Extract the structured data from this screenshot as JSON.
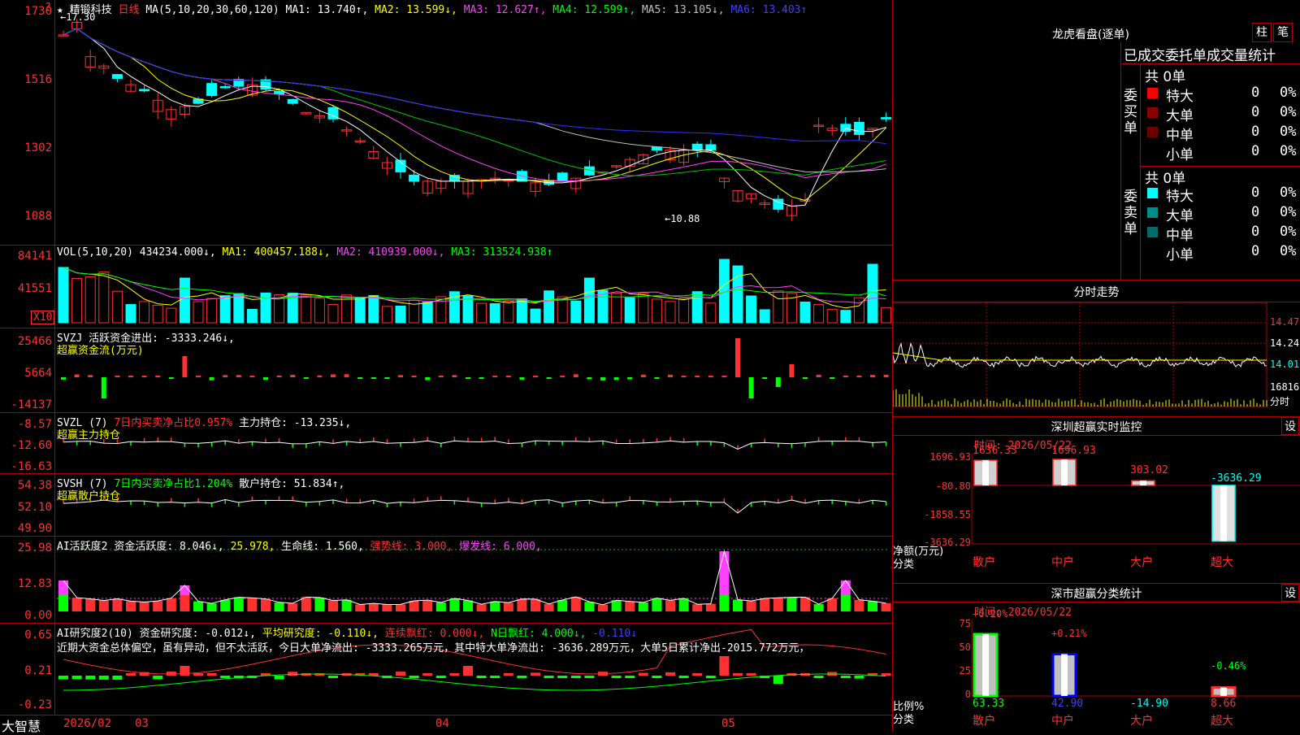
{
  "main": {
    "stock": "精锻科技",
    "period": "日线",
    "ma_label": "MA(5,10,20,30,60,120)",
    "ma1": "MA1: 13.740↑,",
    "ma2": "MA2: 13.599↓,",
    "ma3": "MA3: 12.627↑,",
    "ma4": "MA4: 12.599↑,",
    "ma5": "MA5: 13.105↓,",
    "ma6": "MA6: 13.403↑",
    "high_mark": "←17.30",
    "low_mark": "←10.88",
    "y_labels": [
      "1730",
      "1516",
      "1302",
      "1088"
    ],
    "corner": "?"
  },
  "vol": {
    "label": "VOL(5,10,20)",
    "value": "434234.000↓,",
    "ma1": "MA1: 400457.188↓,",
    "ma2": "MA2: 410939.000↓,",
    "ma3": "MA3: 313524.938↑",
    "y_labels": [
      "84141",
      "41551"
    ],
    "unit": "X10"
  },
  "svzj": {
    "label": "SVZJ",
    "desc": "活跃资金进出: -3333.246↓,",
    "sub": "超赢资金流(万元)",
    "y_labels": [
      "25466",
      "5664",
      "-14137"
    ]
  },
  "svzl": {
    "label": "SVZL (7)",
    "ratio": "7日内买卖净占比0.957%",
    "hold": "主力持仓: -13.235↓,",
    "sub": "超赢主力持仓",
    "y_labels": [
      "-8.57",
      "-12.60",
      "-16.63"
    ]
  },
  "svsh": {
    "label": "SVSH (7)",
    "ratio": "7日内买卖净占比1.204%",
    "hold": "散户持仓: 51.834↑,",
    "sub": "超赢散户持仓",
    "y_labels": [
      "54.38",
      "52.10",
      "49.90"
    ]
  },
  "ai2": {
    "label": "AI活跃度2",
    "val": "资金活跃度: 8.046↓,",
    "v2": "25.978,",
    "life": "生命线: 1.560,",
    "strong": "强势线: 3.000,",
    "burst": "爆发线: 6.000,",
    "y_labels": [
      "25.98",
      "12.83",
      "0.00"
    ]
  },
  "ai3": {
    "label": "AI研究度2(10)",
    "val": "资金研究度: -0.012↓,",
    "avg": "平均研究度: -0.110↓,",
    "cont": "连续飘红: 0.000↓,",
    "nday": "N日飘红: 4.000↓,",
    "last": "-0.110↓",
    "comment": "近期大资金总体偏空，虽有异动，但不太活跃，今日大单净流出: -3333.265万元，其中特大单净流出: -3636.289万元，大单5日累计净出-2015.772万元，",
    "y_labels": [
      "0.65",
      "0.21",
      "-0.23"
    ]
  },
  "bottom": {
    "brand": "大智慧",
    "dates": [
      "2026/02",
      "03",
      "04",
      "05"
    ]
  },
  "right": {
    "title": "龙虎看盘(逐单)",
    "btn1": "柱",
    "btn2": "笔",
    "tabs": "已成交委托单成交量统计",
    "buy_title": "委买单",
    "sell_title": "委卖单",
    "buy_total": "共 0单",
    "sell_total": "共 0单",
    "buy_rows": [
      {
        "name": "特大",
        "n": "0",
        "p": "0%"
      },
      {
        "name": "大单",
        "n": "0",
        "p": "0%"
      },
      {
        "name": "中单",
        "n": "0",
        "p": "0%"
      },
      {
        "name": "小单",
        "n": "0",
        "p": "0%"
      }
    ],
    "sell_rows": [
      {
        "name": "特大",
        "n": "0",
        "p": "0%"
      },
      {
        "name": "大单",
        "n": "0",
        "p": "0%"
      },
      {
        "name": "中单",
        "n": "0",
        "p": "0%"
      },
      {
        "name": "小单",
        "n": "0",
        "p": "0%"
      }
    ],
    "intraday_title": "分时走势",
    "intraday_y": [
      "14.47",
      "14.24",
      "14.01",
      "16816",
      "分时"
    ],
    "monitor_title": "深圳超赢实时监控",
    "monitor_time": "时间: 2026/05/22",
    "monitor_set": "设",
    "monitor_y": [
      "1696.93",
      "-80.80",
      "-1858.55",
      "-3636.29"
    ],
    "monitor_axis": "净额(万元)",
    "monitor_axis2": "分类",
    "monitor_cats": [
      "散户",
      "中户",
      "大户",
      "超大"
    ],
    "monitor_vals": [
      "1636.33",
      "1696.93",
      "303.02",
      "-3636.29"
    ],
    "class_title": "深市超赢分类统计",
    "class_time": "时间: 2026/05/22",
    "class_set": "设",
    "class_y": [
      "75",
      "50",
      "25",
      "0"
    ],
    "class_axis": "比例%",
    "class_axis2": "分类",
    "class_cats": [
      "散户",
      "中户",
      "大户",
      "超大"
    ],
    "class_top": [
      "+0.20%",
      "+0.21%",
      "",
      "-0.46%"
    ],
    "class_bottom": [
      "63.33",
      "42.90",
      "-14.90",
      "8.66"
    ]
  },
  "colors": {
    "up": "#ff3030",
    "down": "#00ffff",
    "grid": "#b00000"
  }
}
